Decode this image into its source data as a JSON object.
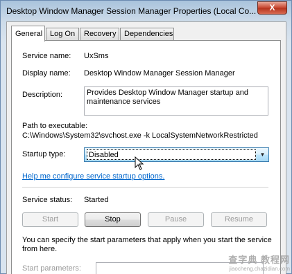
{
  "window": {
    "title": "Desktop Window Manager Session Manager Properties (Local Co...",
    "close_label": "X"
  },
  "tabs": [
    {
      "label": "General",
      "active": true
    },
    {
      "label": "Log On",
      "active": false
    },
    {
      "label": "Recovery",
      "active": false
    },
    {
      "label": "Dependencies",
      "active": false
    }
  ],
  "general": {
    "service_name_label": "Service name:",
    "service_name": "UxSms",
    "display_name_label": "Display name:",
    "display_name": "Desktop Window Manager Session Manager",
    "description_label": "Description:",
    "description": "Provides Desktop Window Manager startup and maintenance services",
    "path_label": "Path to executable:",
    "path": "C:\\Windows\\System32\\svchost.exe -k LocalSystemNetworkRestricted",
    "startup_type_label": "Startup type:",
    "startup_type": "Disabled",
    "help_link": "Help me configure service startup options.",
    "status_label": "Service status:",
    "status": "Started",
    "buttons": {
      "start": "Start",
      "stop": "Stop",
      "pause": "Pause",
      "resume": "Resume"
    },
    "info_text": "You can specify the start parameters that apply when you start the service from here.",
    "start_params_label": "Start parameters:"
  },
  "icons": {
    "close": "close-icon",
    "dropdown": "chevron-down-icon",
    "cursor": "mouse-pointer-icon"
  },
  "watermark": {
    "main": "查字典 教程网",
    "sub": "jiaocheng.chazidian.com"
  },
  "colors": {
    "link": "#0066cc",
    "select_highlight": "#bee6fd",
    "close_button": "#c7442e"
  }
}
